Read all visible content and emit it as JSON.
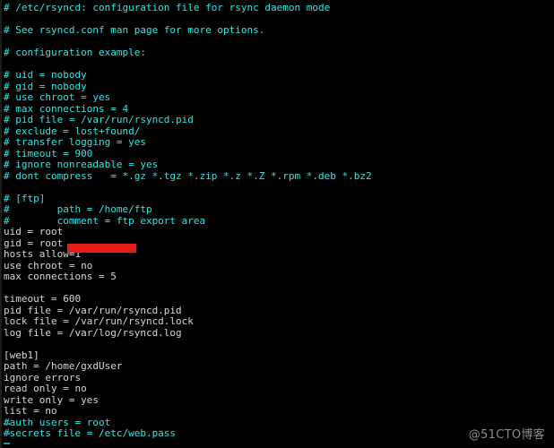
{
  "terminal": {
    "background_color": "#000000",
    "comment_color": "#2fe6e6",
    "text_color": "#d8d8d8",
    "redaction_color": "#e81b1b",
    "lines": [
      {
        "text": "# /etc/rsyncd: configuration file for rsync daemon mode",
        "kind": "comment"
      },
      {
        "text": "",
        "kind": "blank"
      },
      {
        "text": "# See rsyncd.conf man page for more options.",
        "kind": "comment"
      },
      {
        "text": "",
        "kind": "blank"
      },
      {
        "text": "# configuration example:",
        "kind": "comment"
      },
      {
        "text": "",
        "kind": "blank"
      },
      {
        "text": "# uid = nobody",
        "kind": "comment"
      },
      {
        "text": "# gid = nobody",
        "kind": "comment"
      },
      {
        "text": "# use chroot = yes",
        "kind": "comment"
      },
      {
        "text": "# max connections = 4",
        "kind": "comment"
      },
      {
        "text": "# pid file = /var/run/rsyncd.pid",
        "kind": "comment"
      },
      {
        "text": "# exclude = lost+found/",
        "kind": "comment"
      },
      {
        "text": "# transfer logging = yes",
        "kind": "comment"
      },
      {
        "text": "# timeout = 900",
        "kind": "comment"
      },
      {
        "text": "# ignore nonreadable = yes",
        "kind": "comment"
      },
      {
        "text": "# dont compress   = *.gz *.tgz *.zip *.z *.Z *.rpm *.deb *.bz2",
        "kind": "comment"
      },
      {
        "text": "",
        "kind": "blank"
      },
      {
        "text": "# [ftp]",
        "kind": "comment"
      },
      {
        "text": "#        path = /home/ftp",
        "kind": "comment"
      },
      {
        "text": "#        comment = ftp export area",
        "kind": "comment"
      },
      {
        "text": "uid = root",
        "kind": "normal"
      },
      {
        "text": "gid = root",
        "kind": "normal"
      },
      {
        "text": "hosts allow=1",
        "kind": "normal"
      },
      {
        "text": "use chroot = no",
        "kind": "normal"
      },
      {
        "text": "max connections = 5",
        "kind": "normal"
      },
      {
        "text": "",
        "kind": "blank"
      },
      {
        "text": "timeout = 600",
        "kind": "normal"
      },
      {
        "text": "pid file = /var/run/rsyncd.pid",
        "kind": "normal"
      },
      {
        "text": "lock file = /var/run/rsyncd.lock",
        "kind": "normal"
      },
      {
        "text": "log file = /var/log/rsyncd.log",
        "kind": "normal"
      },
      {
        "text": "",
        "kind": "blank"
      },
      {
        "text": "[web1]",
        "kind": "normal"
      },
      {
        "text": "path = /home/gxdUser",
        "kind": "normal"
      },
      {
        "text": "ignore errors",
        "kind": "normal"
      },
      {
        "text": "read only = no",
        "kind": "normal"
      },
      {
        "text": "write only = yes",
        "kind": "normal"
      },
      {
        "text": "list = no",
        "kind": "normal"
      },
      {
        "text": "#auth users = root",
        "kind": "comment"
      },
      {
        "text": "#secrets file = /etc/web.pass",
        "kind": "comment"
      }
    ]
  },
  "watermark": {
    "text": "@51CTO博客"
  }
}
